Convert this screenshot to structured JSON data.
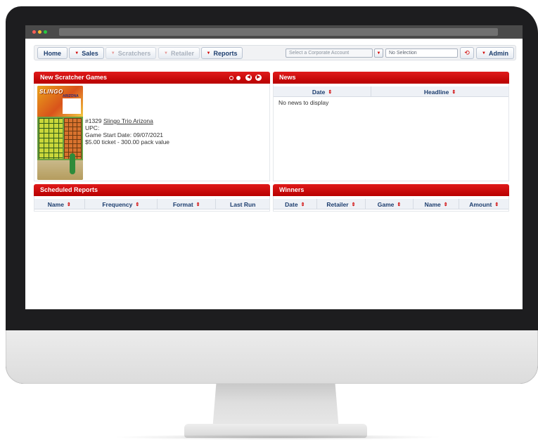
{
  "toolbar": {
    "home_label": "Home",
    "sales_label": "Sales",
    "scratchers_label": "Scratchers",
    "retailer_label": "Retailer",
    "reports_label": "Reports",
    "corporate_account_placeholder": "Select a Corporate Account",
    "selection_value": "No Selection",
    "refresh_icon": "refresh-icon",
    "admin_label": "Admin"
  },
  "new_scratcher_games": {
    "title": "New Scratcher Games",
    "ticket_logo": "SLINGO",
    "ticket_subtitle": "ARIZONA",
    "game_number": "#1329",
    "game_name": "Slingo Trio Arizona",
    "upc_line": "UPC:",
    "start_date_line": "Game Start Date: 09/07/2021",
    "price_line": "$5.00 ticket - 300.00 pack value"
  },
  "news": {
    "title": "News",
    "columns": [
      "Date",
      "Headline"
    ],
    "empty_text": "No news to display"
  },
  "scheduled_reports": {
    "title": "Scheduled Reports",
    "columns": [
      "Name",
      "Frequency",
      "Format",
      "Last Run"
    ]
  },
  "winners": {
    "title": "Winners",
    "columns": [
      "Date",
      "Retailer",
      "Game",
      "Name",
      "Amount"
    ]
  },
  "colors": {
    "accent_red": "#d10000",
    "nav_text": "#1c3d6e"
  }
}
